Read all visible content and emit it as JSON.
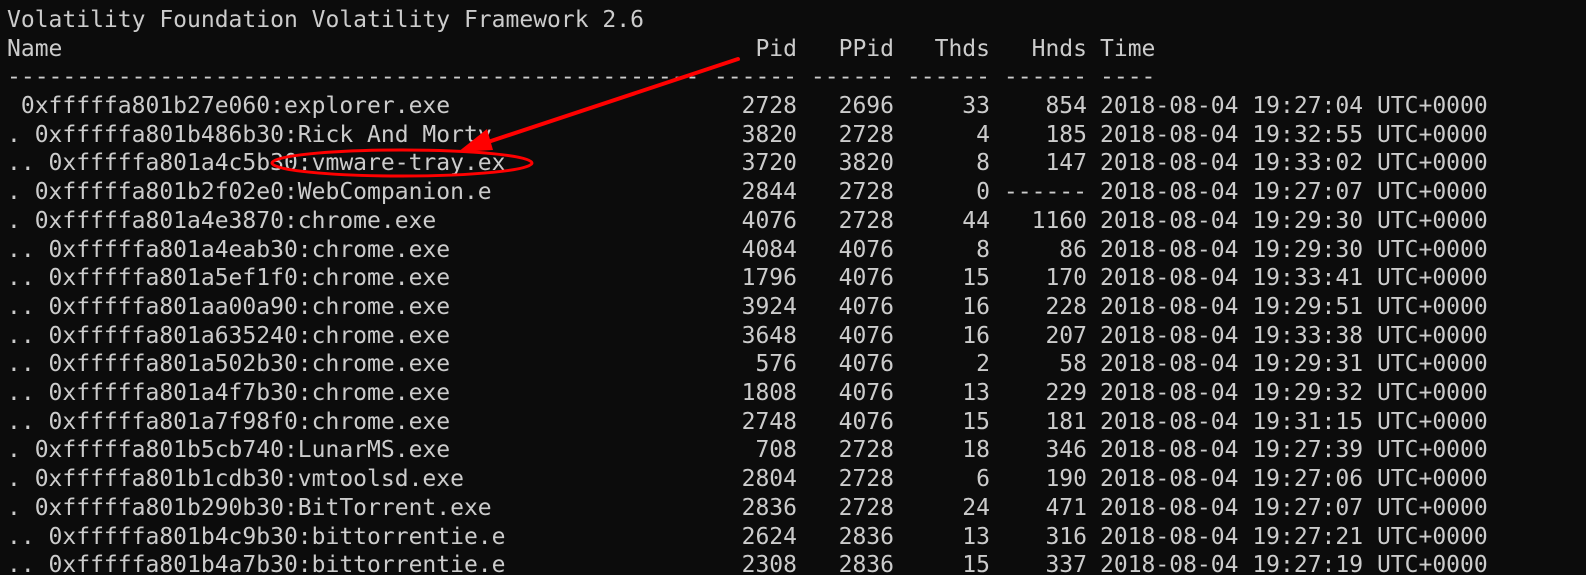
{
  "banner": "Volatility Foundation Volatility Framework 2.6",
  "columns": {
    "name": "Name",
    "pid": "Pid",
    "ppid": "PPid",
    "thds": "Thds",
    "hnds": "Hnds",
    "time": "Time"
  },
  "separators": {
    "name": "--------------------------------------------------",
    "pid": "------",
    "ppid": "------",
    "thds": "------",
    "hnds": "------",
    "time": "----"
  },
  "processes": [
    {
      "name": " 0xfffffa801b27e060:explorer.exe",
      "pid": "2728",
      "ppid": "2696",
      "thds": "33",
      "hnds": "854",
      "time": "2018-08-04 19:27:04 UTC+0000"
    },
    {
      "name": ". 0xfffffa801b486b30:Rick And Morty",
      "pid": "3820",
      "ppid": "2728",
      "thds": "4",
      "hnds": "185",
      "time": "2018-08-04 19:32:55 UTC+0000"
    },
    {
      "name": ".. 0xfffffa801a4c5b30:vmware-tray.ex",
      "pid": "3720",
      "ppid": "3820",
      "thds": "8",
      "hnds": "147",
      "time": "2018-08-04 19:33:02 UTC+0000"
    },
    {
      "name": ". 0xfffffa801b2f02e0:WebCompanion.e",
      "pid": "2844",
      "ppid": "2728",
      "thds": "0",
      "hnds": "------",
      "time": "2018-08-04 19:27:07 UTC+0000"
    },
    {
      "name": ". 0xfffffa801a4e3870:chrome.exe",
      "pid": "4076",
      "ppid": "2728",
      "thds": "44",
      "hnds": "1160",
      "time": "2018-08-04 19:29:30 UTC+0000"
    },
    {
      "name": ".. 0xfffffa801a4eab30:chrome.exe",
      "pid": "4084",
      "ppid": "4076",
      "thds": "8",
      "hnds": "86",
      "time": "2018-08-04 19:29:30 UTC+0000"
    },
    {
      "name": ".. 0xfffffa801a5ef1f0:chrome.exe",
      "pid": "1796",
      "ppid": "4076",
      "thds": "15",
      "hnds": "170",
      "time": "2018-08-04 19:33:41 UTC+0000"
    },
    {
      "name": ".. 0xfffffa801aa00a90:chrome.exe",
      "pid": "3924",
      "ppid": "4076",
      "thds": "16",
      "hnds": "228",
      "time": "2018-08-04 19:29:51 UTC+0000"
    },
    {
      "name": ".. 0xfffffa801a635240:chrome.exe",
      "pid": "3648",
      "ppid": "4076",
      "thds": "16",
      "hnds": "207",
      "time": "2018-08-04 19:33:38 UTC+0000"
    },
    {
      "name": ".. 0xfffffa801a502b30:chrome.exe",
      "pid": "576",
      "ppid": "4076",
      "thds": "2",
      "hnds": "58",
      "time": "2018-08-04 19:29:31 UTC+0000"
    },
    {
      "name": ".. 0xfffffa801a4f7b30:chrome.exe",
      "pid": "1808",
      "ppid": "4076",
      "thds": "13",
      "hnds": "229",
      "time": "2018-08-04 19:29:32 UTC+0000"
    },
    {
      "name": ".. 0xfffffa801a7f98f0:chrome.exe",
      "pid": "2748",
      "ppid": "4076",
      "thds": "15",
      "hnds": "181",
      "time": "2018-08-04 19:31:15 UTC+0000"
    },
    {
      "name": ". 0xfffffa801b5cb740:LunarMS.exe",
      "pid": "708",
      "ppid": "2728",
      "thds": "18",
      "hnds": "346",
      "time": "2018-08-04 19:27:39 UTC+0000"
    },
    {
      "name": ". 0xfffffa801b1cdb30:vmtoolsd.exe",
      "pid": "2804",
      "ppid": "2728",
      "thds": "6",
      "hnds": "190",
      "time": "2018-08-04 19:27:06 UTC+0000"
    },
    {
      "name": ". 0xfffffa801b290b30:BitTorrent.exe",
      "pid": "2836",
      "ppid": "2728",
      "thds": "24",
      "hnds": "471",
      "time": "2018-08-04 19:27:07 UTC+0000"
    },
    {
      "name": ".. 0xfffffa801b4c9b30:bittorrentie.e",
      "pid": "2624",
      "ppid": "2836",
      "thds": "13",
      "hnds": "316",
      "time": "2018-08-04 19:27:21 UTC+0000"
    },
    {
      "name": ".. 0xfffffa801b4a7b30:bittorrentie.e",
      "pid": "2308",
      "ppid": "2836",
      "thds": "15",
      "hnds": "337",
      "time": "2018-08-04 19:27:19 UTC+0000"
    }
  ],
  "colors": {
    "background": "#0c0c0c",
    "text": "#cccccc",
    "annotation": "#ff0000"
  },
  "annotation": {
    "highlighted_process": "vmware-tray.ex",
    "shapes": [
      "arrow-icon",
      "ellipse-highlight"
    ]
  }
}
